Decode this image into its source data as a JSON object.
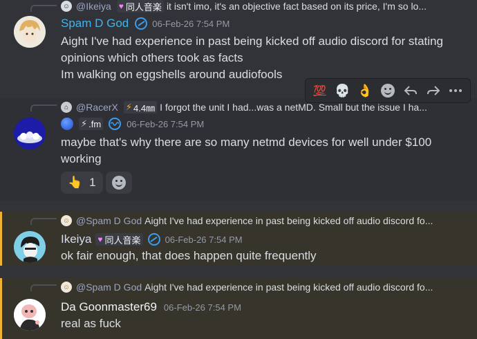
{
  "messages": [
    {
      "reply_name": "@Ikeiya",
      "reply_tag": "同人音楽",
      "reply_text": "it isn't imo, it's an objective fact based on its price, I'm so lo...",
      "username": "Spam D God",
      "username_color": "#3fb5f0",
      "timestamp": "06-Feb-26 7:54 PM",
      "lines": [
        "Aight I've had experience in past being kicked off audio discord for stating",
        "opinions which others took as facts",
        "Im walking on eggshells around audiofools"
      ]
    },
    {
      "reply_name": "@RacerX",
      "reply_tag": "4.4㎜",
      "reply_text": "I forgot the unit  I had...was a netMD.  Small but the issue I ha...",
      "username": "",
      "tag": ".fm",
      "timestamp": "06-Feb-26 7:54 PM",
      "lines": [
        "maybe that's why there are so many netmd devices for well under $100",
        "working"
      ],
      "reaction": {
        "emoji": "👆",
        "count": "1"
      }
    },
    {
      "reply_name": "@Spam D God",
      "reply_text": "Aight I've had experience in past being kicked off audio discord fo...",
      "username": "Ikeiya",
      "username_color": "#d6dce8",
      "tag": "同人音楽",
      "timestamp": "06-Feb-26 7:54 PM",
      "lines": [
        "ok fair enough, that does happen quite frequently"
      ]
    },
    {
      "reply_name": "@Spam D God",
      "reply_text": "Aight I've had experience in past being kicked off audio discord fo...",
      "username": "Da Goonmaster69",
      "username_color": "#f2f3f5",
      "timestamp": "06-Feb-26 7:54 PM",
      "lines": [
        "real as fuck"
      ]
    }
  ],
  "toolbar": {
    "emoji_1": "💯",
    "emoji_2": "💀",
    "emoji_3": "👌",
    "reaction_icon": "add-reaction-icon",
    "reply_icon": "reply-icon",
    "forward_icon": "forward-icon",
    "more_icon": "more-icon"
  },
  "colors": {
    "mention_bar": "#f0b232",
    "link_blue": "#3b9cf0",
    "background": "#313338"
  }
}
